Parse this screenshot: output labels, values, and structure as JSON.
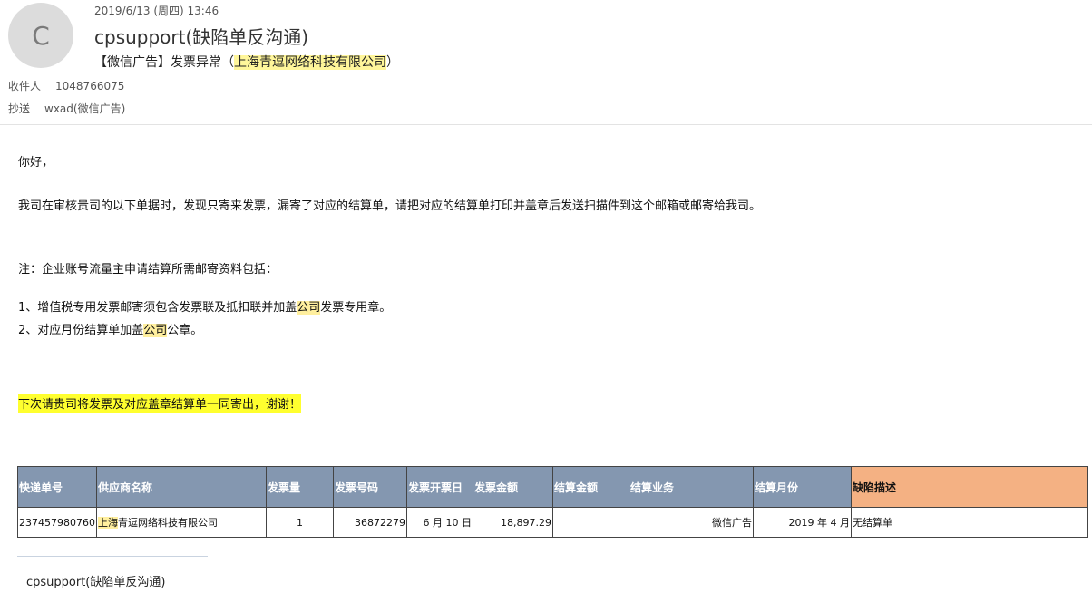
{
  "email": {
    "avatar_letter": "C",
    "date": "2019/6/13 (周四) 13:46",
    "sender": "cpsupport(缺陷单反沟通)",
    "subject_prefix": "【微信广告】发票异常（",
    "subject_company": "上海青逗网络科技有限公司",
    "subject_suffix": "）",
    "to_label": "收件人",
    "to_value": "1048766075",
    "cc_label": "抄送",
    "cc_value": "wxad(微信广告)"
  },
  "body": {
    "greeting": "你好，",
    "paragraph": "我司在审核贵司的以下单据时，发现只寄来发票，漏寄了对应的结算单，请把对应的结算单打印并盖章后发送扫描件到这个邮箱或邮寄给我司。",
    "note": "注：企业账号流量主申请结算所需邮寄资料包括：",
    "item1_before": "1、增值税专用发票邮寄须包含发票联及抵扣联并加盖",
    "item1_hl": "公司",
    "item1_after": "发票专用章。",
    "item2_before": "2、对应月份结算单加盖",
    "item2_hl": "公司",
    "item2_after": "公章。",
    "highlight_notice": "下次请贵司将发票及对应盖章结算单一同寄出，谢谢！"
  },
  "table": {
    "headers": [
      "快递单号",
      "供应商名称",
      "发票量",
      "发票号码",
      "发票开票日",
      "发票金额",
      "结算金额",
      "结算业务",
      "结算月份",
      "缺陷描述"
    ],
    "row": {
      "tracking": "237457980760",
      "supplier_hl": "上海",
      "supplier_rest": "青逗网络科技有限公司",
      "invoice_count": "1",
      "invoice_no": "36872279",
      "invoice_date": "6 月 10 日",
      "invoice_amount": "18,897.29",
      "settle_amount": "",
      "business": "微信广告",
      "month": "2019 年 4 月",
      "defect": "无结算单"
    }
  },
  "signature": "cpsupport(缺陷单反沟通)"
}
